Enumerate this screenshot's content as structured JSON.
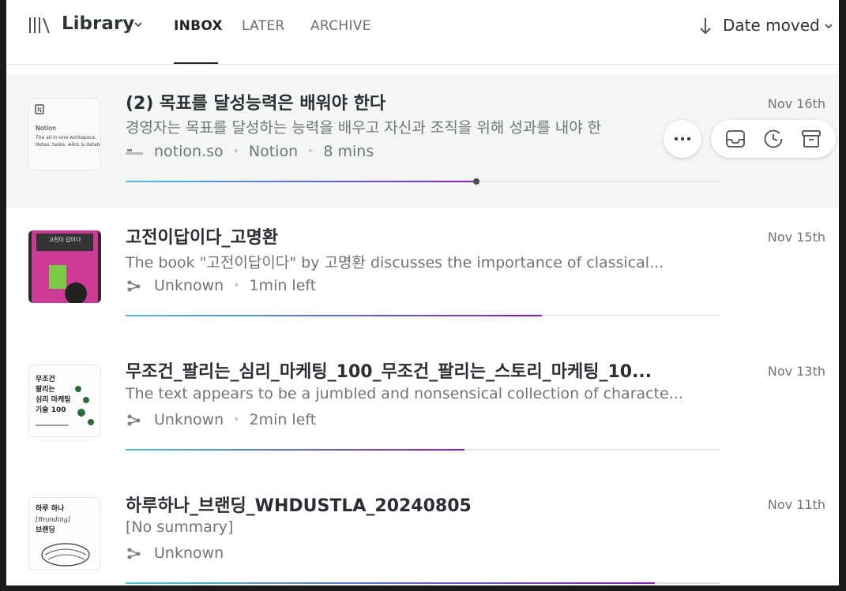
{
  "header": {
    "library_label": "Library",
    "tabs": [
      {
        "label": "INBOX",
        "active": true
      },
      {
        "label": "LATER",
        "active": false
      },
      {
        "label": "ARCHIVE",
        "active": false
      }
    ],
    "sort_label": "Date moved"
  },
  "items": [
    {
      "title": "(2) 목표를 달성능력은 배워야 한다",
      "summary": "경영자는 목표를 달성하는 능력을 배우고 자신과 조직을 위해 성과를 내야 한",
      "site": "notion.so",
      "author": "Notion",
      "time": "8 mins",
      "date": "Nov 16th",
      "progress": 0.59,
      "thumb_text": [
        "Notion",
        "The all-in-one workspace.",
        "Notes, tasks, wikis & databases."
      ]
    },
    {
      "title": "고전이답이다_고명환",
      "summary": "The book \"고전이답이다\" by 고명환 discusses the importance of classical...",
      "author": "Unknown",
      "time": "1min left",
      "date": "Nov 15th",
      "progress": 0.7,
      "thumb_text": [
        "고전이 답이다"
      ]
    },
    {
      "title": "무조건_팔리는_심리_마케팅_100_무조건_팔리는_스토리_마케팅_10...",
      "summary": "The text appears to be a jumbled and nonsensical collection of characte...",
      "author": "Unknown",
      "time": "2min left",
      "date": "Nov 13th",
      "progress": 0.57,
      "thumb_text": [
        "무조건",
        "팔리는",
        "심리 마케팅",
        "기술 100"
      ]
    },
    {
      "title": "하루하나_브랜딩_WHDUSTLA_20240805",
      "summary": "[No summary]",
      "author": "Unknown",
      "date": "Nov 11th",
      "progress": 0.89,
      "thumb_text": [
        "하루 하나",
        "Branding",
        "브랜딩"
      ]
    }
  ],
  "colors": {
    "accent_start": "#4ec3d6",
    "accent_end": "#8a1bb5",
    "highlight_row": "#f4f6f6"
  },
  "icons": [
    "library-icon",
    "chevron-down-icon",
    "arrow-down-icon",
    "more-icon",
    "inbox-icon",
    "clock-icon",
    "archive-icon",
    "branch-icon"
  ]
}
